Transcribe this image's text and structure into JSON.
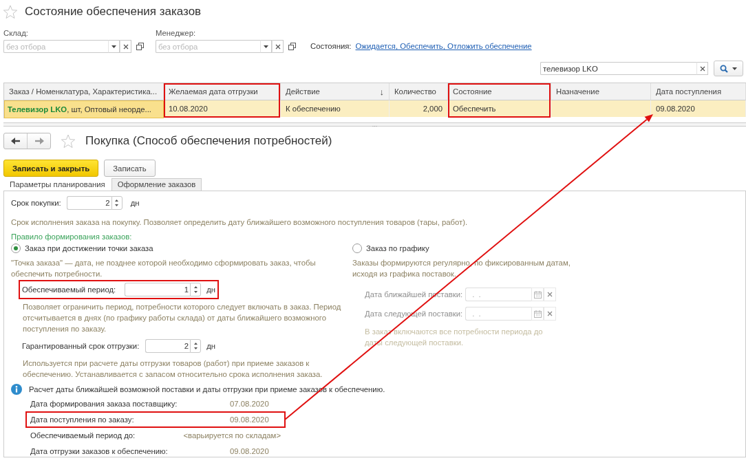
{
  "list_form": {
    "title": "Состояние обеспечения заказов",
    "filters": [
      {
        "label": "Склад:",
        "placeholder": "без отбора"
      },
      {
        "label": "Менеджер:",
        "placeholder": "без отбора"
      }
    ],
    "states_label": "Состояния:",
    "states_link": "Ожидается, Обеспечить, Отложить обеспечение",
    "search": {
      "value": "телевизор LKO"
    },
    "table": {
      "columns": [
        {
          "label": "Заказ / Номенклатура, Характеристика...",
          "highlighted": false
        },
        {
          "label": "Желаемая дата отгрузки",
          "highlighted": true
        },
        {
          "label": "Действие",
          "highlighted": false,
          "sort_mark": "↓"
        },
        {
          "label": "Количество",
          "highlighted": false,
          "kind": "number"
        },
        {
          "label": "Состояние",
          "highlighted": true
        },
        {
          "label": "Назначение",
          "highlighted": false
        },
        {
          "label": "Дата поступления",
          "highlighted": false
        }
      ],
      "rows": [
        {
          "selected": true,
          "cells": [
            "**Телевизор LKO**, шт, Оптовый неорде...",
            "10.08.2020",
            "К обеспечению",
            "2,000",
            "Обеспечить",
            "",
            "09.08.2020"
          ]
        }
      ]
    }
  },
  "splitter_mark": "...",
  "detail_form": {
    "title": "Покупка (Способ обеспечения потребностей)",
    "buttons": [
      {
        "label": "Записать и закрыть",
        "kind": "primary"
      },
      {
        "label": "Записать",
        "kind": "normal"
      }
    ],
    "tabs": [
      {
        "label": "Параметры планирования",
        "selected": true
      },
      {
        "label": "Оформление заказов",
        "selected": false
      }
    ],
    "purchase_term": {
      "label": "Срок покупки:",
      "value": "2",
      "unit": "дн"
    },
    "purchase_hint": "Срок исполнения заказа на покупку. Позволяет определить дату ближайшего возможного поступления товаров (тары, работ).",
    "rule_label": "Правило формирования заказов:",
    "options": [
      {
        "label": "Заказ при достижении точки заказа",
        "selected": true,
        "hint": "\"Точка заказа\" — дата, не позднее которой необходимо сформировать заказ, чтобы обеспечить потребности."
      },
      {
        "label": "Заказ по графику",
        "selected": false,
        "hint": "Заказы формируются регулярно, по фиксированным датам, исходя из графика поставок."
      }
    ],
    "left_fields": [
      {
        "label": "Обеспечиваемый период:",
        "value": "1",
        "unit": "дн",
        "highlighted": true,
        "hint": "Позволяет ограничить период, потребности которого следует включать в заказ. Период отсчитывается в днях (по графику работы склада) от даты ближайшего возможного поступления по заказу."
      },
      {
        "label": "Гарантированный срок отгрузки:",
        "value": "2",
        "unit": "дн",
        "highlighted": false,
        "hint": "Используется при расчете даты отгрузки товаров (работ) при приеме заказов к обеспечению. Устанавливается с запасом относительно срока исполнения заказа."
      }
    ],
    "right_fields": [
      {
        "label": "Дата ближайшей поставки:",
        "placeholder": " .  .",
        "disabled": true
      },
      {
        "label": "Дата следующей поставки:",
        "placeholder": " .  .",
        "disabled": true
      }
    ],
    "right_hint": "В заказ включаются все потребности периода до даты следующей поставки.",
    "info": "Расчет даты ближайшей возможной поставки и даты отгрузки при приеме заказов к обеспечению.",
    "calc_rows": [
      {
        "label": "Дата формирования заказа поставщику:",
        "value": "07.08.2020",
        "highlighted": false
      },
      {
        "label": "Дата поступления по заказу:",
        "value": "09.08.2020",
        "highlighted": true
      },
      {
        "label": "Обеспечиваемый период до:",
        "value": "<варьируется по складам>",
        "highlighted": false
      },
      {
        "label": "Дата отгрузки заказов к обеспечению:",
        "value": "09.08.2020",
        "highlighted": false
      }
    ]
  },
  "annotation_arrow": true
}
